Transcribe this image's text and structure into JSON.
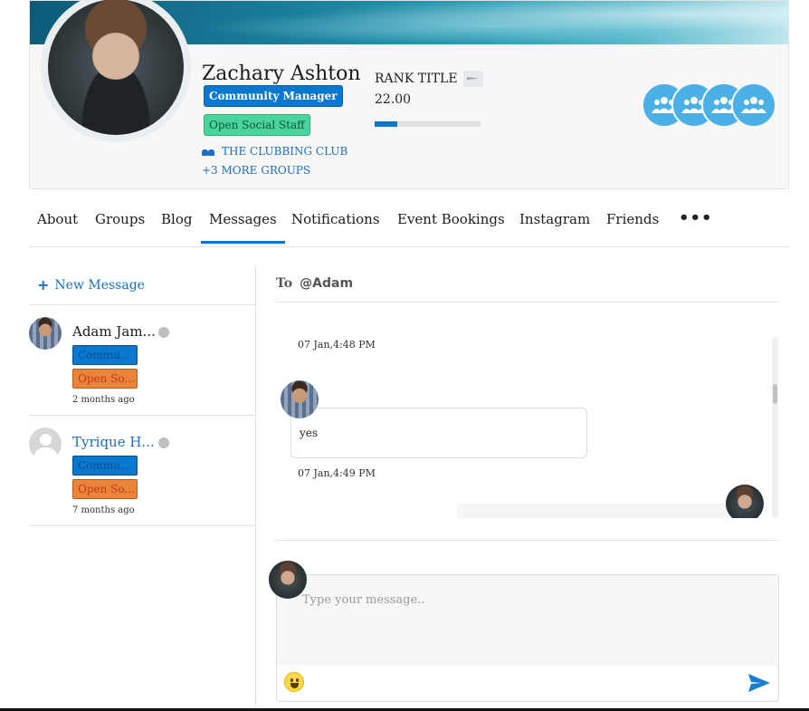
{
  "profile": {
    "name": "Zachary Ashton",
    "badges": {
      "community_manager": "Community Manager",
      "open_social_staff": "Open Social Staff"
    },
    "group": "THE CLUBBING CLUB",
    "more_groups": "+3 MORE GROUPS",
    "rank_title": "RANK TITLE",
    "rank_value": "22.00",
    "rank_progress": 0.21,
    "group_bubble_icon": "group-icon",
    "group_bubble_count": 4,
    "colors": {
      "accent": "#0b78d0",
      "staff": "#48d49b",
      "bubble": "#4ab0e6"
    }
  },
  "tabs": [
    {
      "label": "About"
    },
    {
      "label": "Groups"
    },
    {
      "label": "Blog"
    },
    {
      "label": "Messages",
      "active": true
    },
    {
      "label": "Notifications"
    },
    {
      "label": "Event Bookings"
    },
    {
      "label": "Instagram"
    },
    {
      "label": "Friends"
    }
  ],
  "tabs_more": "•••",
  "conversations": {
    "new_message": "New Message",
    "items": [
      {
        "name": "Adam Jam...",
        "badge1": "Commu...",
        "badge2": "Open So...",
        "time": "2 months ago",
        "status": "offline"
      },
      {
        "name": "Tyrique H...",
        "badge1": "Commu...",
        "badge2": "Open So...",
        "time": "7 months ago",
        "status": "offline"
      }
    ]
  },
  "chat": {
    "to_label": "To",
    "to_value": "@Adam",
    "messages": [
      {
        "time": "07 Jan,4:48 PM",
        "text": "yes",
        "direction": "incoming"
      },
      {
        "time": "07 Jan,4:49 PM",
        "text": "",
        "direction": "outgoing"
      }
    ],
    "composer_placeholder": "Type your message.."
  }
}
